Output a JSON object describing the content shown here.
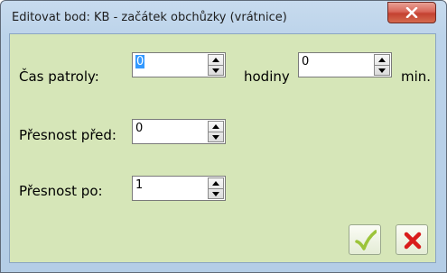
{
  "window": {
    "title": "Editovat bod: KB - začátek obchůzky (vrátnice)"
  },
  "form": {
    "patrol_time_label": "Čas patroly:",
    "hours_value": "0",
    "hours_unit": "hodiny",
    "minutes_value": "0",
    "minutes_unit": "min.",
    "accuracy_before_label": "Přesnost před:",
    "accuracy_before_value": "0",
    "accuracy_after_label": "Přesnost po:",
    "accuracy_after_value": "1"
  },
  "icons": {
    "close": "close-icon",
    "confirm": "checkmark-icon",
    "cancel": "cross-icon"
  },
  "colors": {
    "client_background": "#d6e6b8",
    "title_bar": "#bcd3ea",
    "close_button": "#c44131",
    "confirm_check": "#9cc43a",
    "cancel_cross": "#d91c1c"
  }
}
